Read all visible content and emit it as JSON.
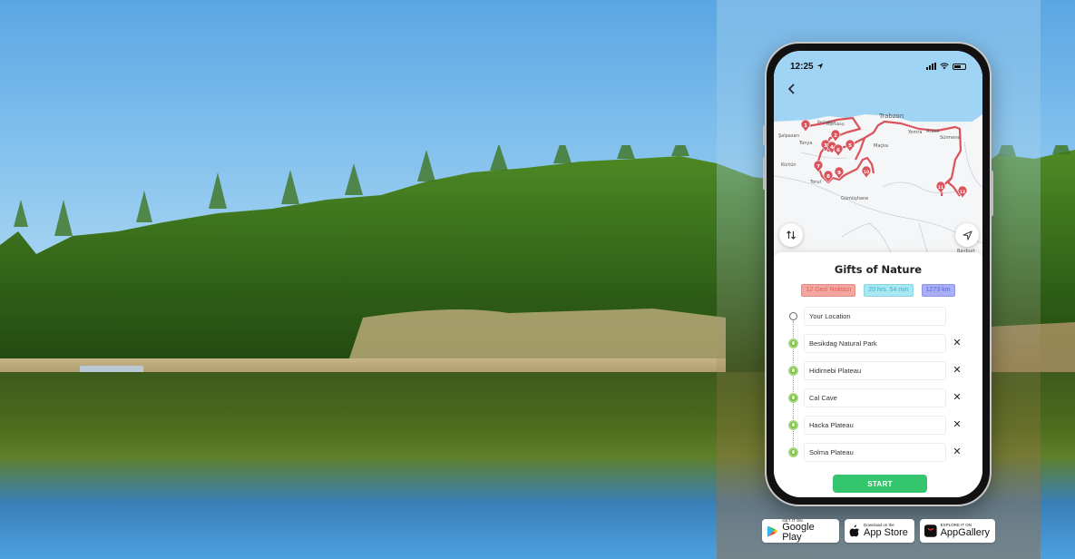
{
  "phone": {
    "status_bar": {
      "time": "12:25",
      "location_icon": "location-arrow-icon",
      "signal_icon": "cellular-signal-icon",
      "wifi_icon": "wifi-icon",
      "battery_icon": "battery-icon"
    },
    "back_icon": "chevron-left-icon",
    "map": {
      "places": [
        "Trabzon",
        "Yomra",
        "Arakli",
        "Sürmene",
        "Şalpazarı",
        "Tonya",
        "Maçka",
        "Köprübaşı",
        "Torul",
        "Gümüşhane",
        "Kürtün",
        "Bayburt",
        "Beşikdüzü"
      ],
      "markers": [
        "1",
        "2",
        "3",
        "4",
        "5",
        "6",
        "7",
        "8",
        "9",
        "10",
        "11",
        "12"
      ],
      "route_color": "#d9545c",
      "sea_color": "#9fd4f5",
      "swap_button_icon": "swap-vertical-icon",
      "locate_button_icon": "navigation-arrow-icon"
    },
    "sheet": {
      "title": "Gifts of Nature",
      "badges": [
        {
          "label": "12 Gezi Noktası",
          "color": "red"
        },
        {
          "label": "20 hrs. 54 min",
          "color": "cyan"
        },
        {
          "label": "1273 km",
          "color": "blue"
        }
      ],
      "origin": {
        "value": "Your Location"
      },
      "stops": [
        {
          "value": "Besikdag Natural Park"
        },
        {
          "value": "Hidirnebi Plateau"
        },
        {
          "value": "Cal Cave"
        },
        {
          "value": "Hacka Plateau"
        },
        {
          "value": "Solma Plateau"
        }
      ],
      "remove_icon": "close-icon",
      "start_label": "START",
      "accent_color": "#35c56f"
    }
  },
  "stores": {
    "google_play": {
      "small": "GET IT ON",
      "big": "Google Play"
    },
    "app_store": {
      "small": "Download on the",
      "big": "App Store"
    },
    "app_gallery": {
      "small": "EXPLORE IT ON",
      "big": "AppGallery"
    }
  }
}
